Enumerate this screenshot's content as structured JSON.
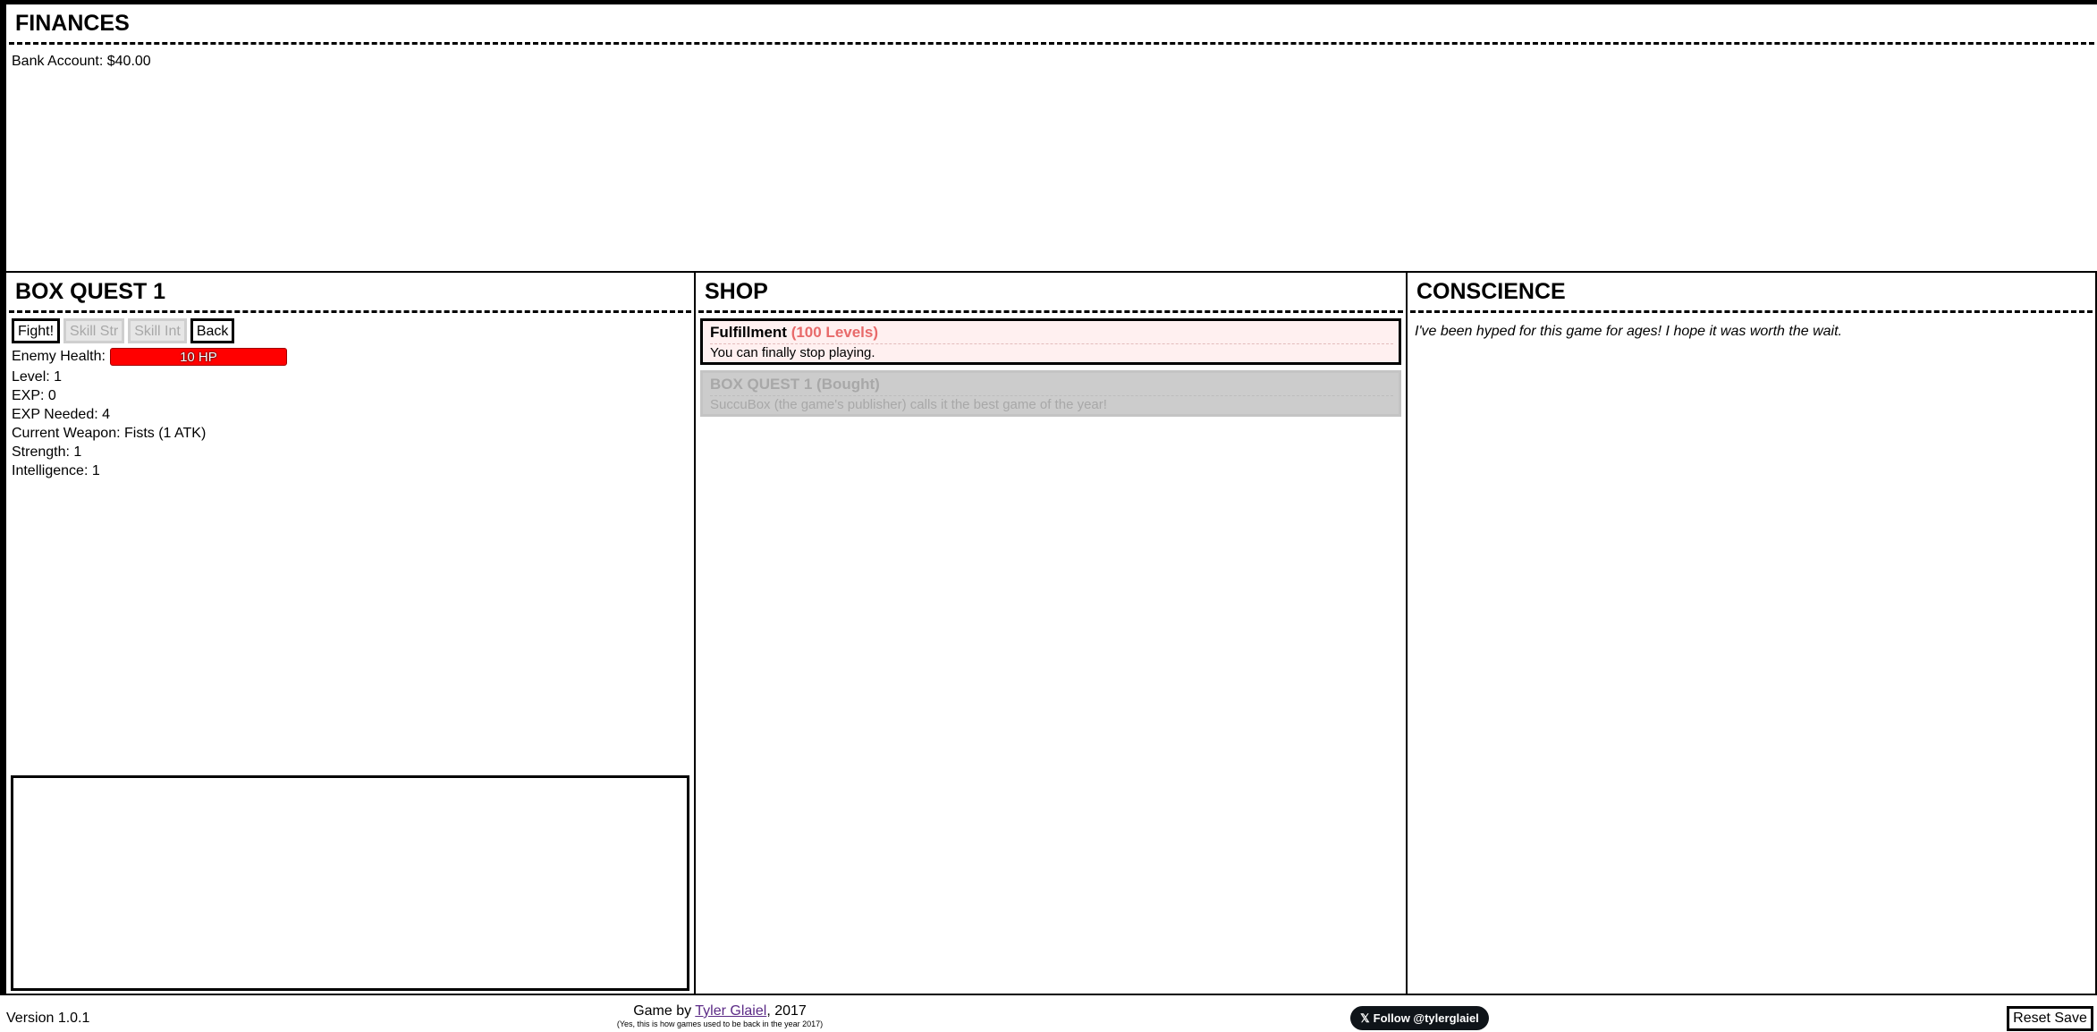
{
  "finances": {
    "title": "FINANCES",
    "bank_label": "Bank Account:",
    "bank_value": "$40.00"
  },
  "box_quest": {
    "title": "BOX QUEST 1",
    "buttons": {
      "fight": "Fight!",
      "skill_str": "Skill Str",
      "skill_int": "Skill Int",
      "back": "Back"
    },
    "enemy_health_label": "Enemy Health:",
    "enemy_health_value": "10 HP",
    "stats": [
      {
        "label": "Level:",
        "value": "1"
      },
      {
        "label": "EXP:",
        "value": "0"
      },
      {
        "label": "EXP Needed:",
        "value": "4"
      },
      {
        "label": "Current Weapon:",
        "value": "Fists (1 ATK)"
      },
      {
        "label": "Strength:",
        "value": "1"
      },
      {
        "label": "Intelligence:",
        "value": "1"
      }
    ]
  },
  "shop": {
    "title": "SHOP",
    "items": [
      {
        "name": "Fulfillment",
        "cost": "(100 Levels)",
        "desc": "You can finally stop playing."
      },
      {
        "name": "BOX QUEST 1",
        "cost": "(Bought)",
        "desc": "SuccuBox (the game's publisher) calls it the best game of the year!"
      }
    ]
  },
  "conscience": {
    "title": "CONSCIENCE",
    "text": "I've been hyped for this game for ages! I hope it was worth the wait."
  },
  "footer": {
    "version": "Version 1.0.1",
    "credit_prefix": "Game by ",
    "author": "Tyler Glaiel",
    "credit_suffix": ", 2017",
    "small_note": "(Yes, this is how games used to be back in the year 2017)",
    "follow_label": "Follow @tylerglaiel",
    "reset_label": "Reset Save"
  }
}
